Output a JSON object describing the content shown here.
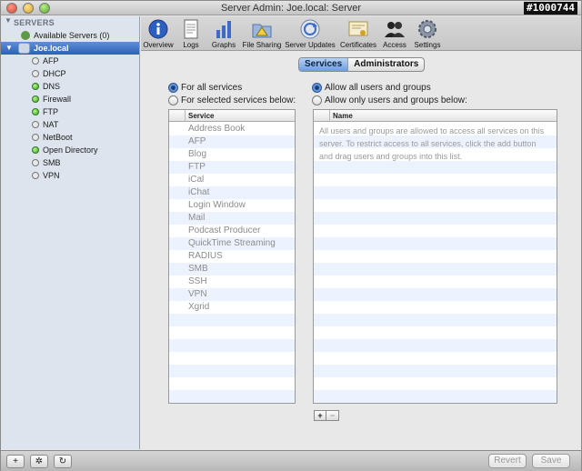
{
  "window": {
    "title": "Server Admin: Joe.local: Server",
    "badge": "#1000744"
  },
  "sidebar": {
    "header": "SERVERS",
    "available": "Available Servers (0)",
    "selected_server": "Joe.local",
    "services": [
      {
        "label": "AFP",
        "running": false
      },
      {
        "label": "DHCP",
        "running": false
      },
      {
        "label": "DNS",
        "running": true
      },
      {
        "label": "Firewall",
        "running": true
      },
      {
        "label": "FTP",
        "running": true
      },
      {
        "label": "NAT",
        "running": false
      },
      {
        "label": "NetBoot",
        "running": false
      },
      {
        "label": "Open Directory",
        "running": true
      },
      {
        "label": "SMB",
        "running": false
      },
      {
        "label": "VPN",
        "running": false
      }
    ]
  },
  "toolbar": {
    "items": [
      {
        "label": "Overview",
        "icon": "info-icon"
      },
      {
        "label": "Logs",
        "icon": "logs-icon"
      },
      {
        "label": "Graphs",
        "icon": "graphs-icon"
      },
      {
        "label": "File Sharing",
        "icon": "file-sharing-icon"
      },
      {
        "label": "Server Updates",
        "icon": "server-updates-icon"
      },
      {
        "label": "Certificates",
        "icon": "certificates-icon"
      },
      {
        "label": "Access",
        "icon": "access-icon"
      },
      {
        "label": "Settings",
        "icon": "gear-icon"
      }
    ]
  },
  "tabs": {
    "services": "Services",
    "administrators": "Administrators"
  },
  "services_panel": {
    "radio_all": "For all services",
    "radio_selected": "For selected services below:",
    "column": "Service",
    "items": [
      "Address Book",
      "AFP",
      "Blog",
      "FTP",
      "iCal",
      "iChat",
      "Login Window",
      "Mail",
      "Podcast Producer",
      "QuickTime Streaming",
      "RADIUS",
      "SMB",
      "SSH",
      "VPN",
      "Xgrid"
    ]
  },
  "users_panel": {
    "radio_all": "Allow all users and groups",
    "radio_only": "Allow only users and groups below:",
    "column": "Name",
    "note": "All users and groups are allowed to access all services on this server. To restrict access to all services, click the add button and drag users and groups into this list."
  },
  "bottom": {
    "add": "+",
    "action": "✲",
    "refresh": "↻",
    "revert": "Revert",
    "save": "Save"
  },
  "colors": {
    "selection": "#2d60b8",
    "running": "#3fa42a"
  }
}
